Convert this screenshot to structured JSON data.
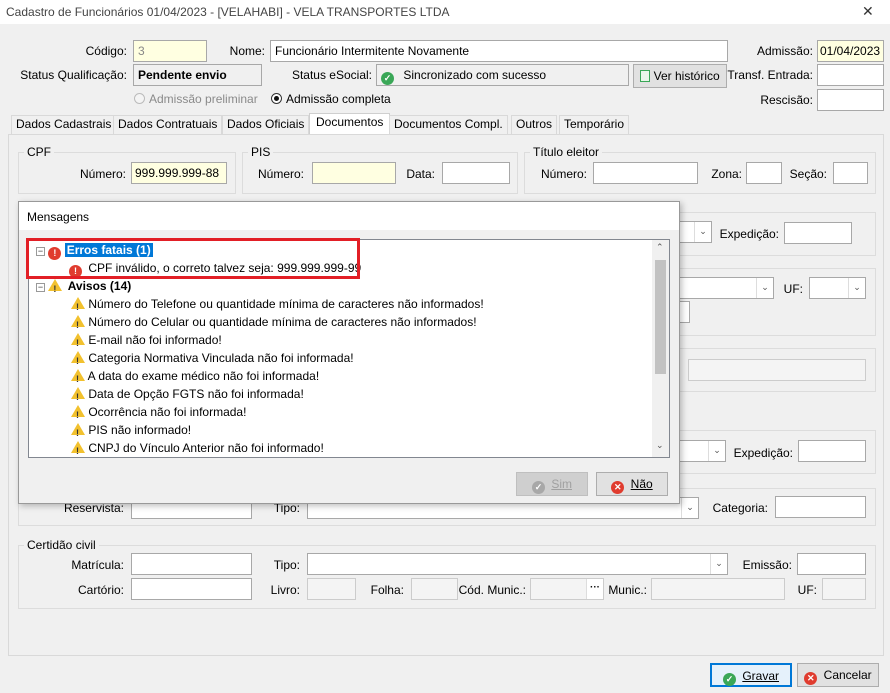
{
  "window": {
    "title": "Cadastro de Funcionários  01/04/2023 - [VELAHABI] - VELA TRANSPORTES LTDA",
    "close": "✕"
  },
  "header": {
    "codigo_label": "Código:",
    "codigo_value": "3",
    "nome_label": "Nome:",
    "nome_value": "Funcionário Intermitente Novamente",
    "admissao_label": "Admissão:",
    "admissao_value": "01/04/2023",
    "status_qualif_label": "Status Qualificação:",
    "status_qualif_value": "Pendente envio",
    "status_esocial_label": "Status eSocial:",
    "status_esocial_value": "Sincronizado com sucesso",
    "ver_historico": "Ver histórico",
    "transf_label": "Transf. Entrada:",
    "rescisao_label": "Rescisão:",
    "radio_preliminar": "Admissão preliminar",
    "radio_completa": "Admissão completa"
  },
  "tabs": [
    "Dados Cadastrais",
    "Dados Contratuais",
    "Dados Oficiais",
    "Documentos",
    "Documentos Compl.",
    "Outros",
    "Temporário"
  ],
  "documentos": {
    "cpf_group": "CPF",
    "numero_label": "Número:",
    "cpf_value": "999.999.999-88",
    "pis_group": "PIS",
    "data_label": "Data:",
    "titulo_group": "Título eleitor",
    "zona_label": "Zona:",
    "secao_label": "Seção:",
    "expedicao_label": "Expedição:",
    "uf_label": "UF:",
    "reservista_label": "Reservista:",
    "tipo_label": "Tipo:",
    "categoria_label": "Categoria:",
    "certidao_group": "Certidão civil",
    "matricula_label": "Matrícula:",
    "emissao_label": "Emissão:",
    "cartorio_label": "Cartório:",
    "livro_label": "Livro:",
    "folha_label": "Folha:",
    "cod_munic_label": "Cód. Munic.:",
    "munic_label": "Munic.:",
    "ellipsis": "···"
  },
  "dialog": {
    "title": "Mensagens",
    "erros_header": "Erros fatais (1)",
    "erros": [
      "CPF inválido, o correto talvez seja: 999.999.999-99"
    ],
    "avisos_header": "Avisos (14)",
    "avisos": [
      "Número do Telefone ou quantidade mínima de caracteres não informados!",
      "Número do Celular ou quantidade mínima de caracteres não informados!",
      "E-mail não foi informado!",
      "Categoria Normativa Vinculada não foi informada!",
      "A data do exame médico não foi informada!",
      "Data de Opção FGTS não foi informada!",
      "Ocorrência não foi informada!",
      "PIS não informado!",
      "CNPJ do Vínculo Anterior não foi informado!"
    ],
    "sim": "Sim",
    "nao": "Não"
  },
  "footer": {
    "gravar": "Gravar",
    "cancelar": "Cancelar"
  },
  "colors": {
    "highlight": "#0078d7",
    "error_red": "#e03c2f",
    "callout": "#e21f26",
    "ok_green": "#3aa757",
    "yellow_field": "#ffffe1"
  }
}
